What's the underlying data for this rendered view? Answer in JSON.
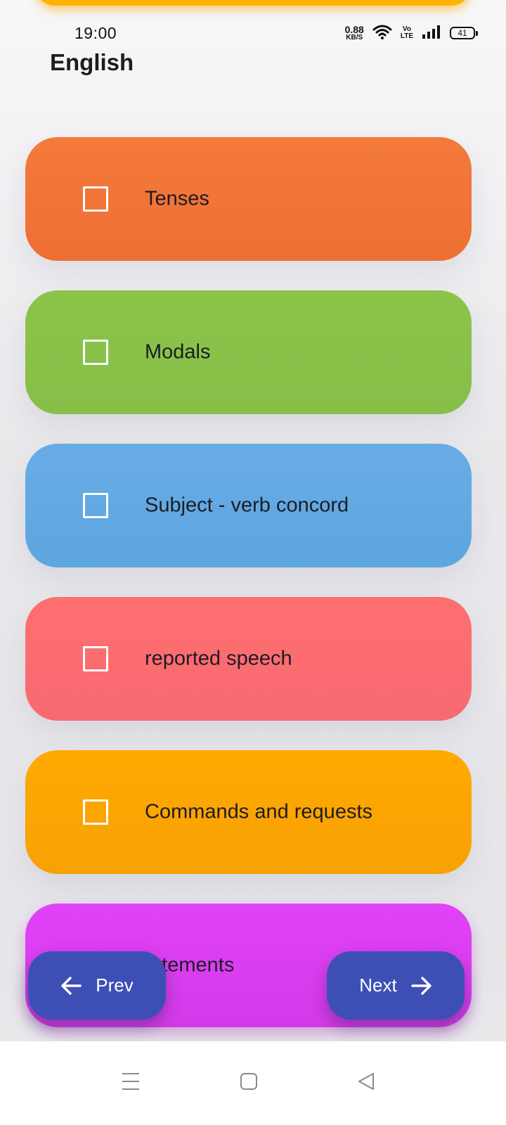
{
  "status_bar": {
    "time": "19:00",
    "net_speed_value": "0.88",
    "net_speed_unit": "KB/S",
    "volte_top": "Vo",
    "volte_bottom": "LTE",
    "battery": "41"
  },
  "header": {
    "title": "English"
  },
  "topics": [
    {
      "label": "Tenses",
      "color": "#f47a3c",
      "checked": false
    },
    {
      "label": "Modals",
      "color": "#8cc44a",
      "checked": false
    },
    {
      "label": "Subject - verb concord",
      "color": "#68ace6",
      "checked": false
    },
    {
      "label": "reported speech",
      "color": "#ff6f6f",
      "checked": false
    },
    {
      "label": "Commands and requests",
      "color": "#ffa901",
      "checked": false
    },
    {
      "label": "tatements",
      "color": "#e242f8",
      "checked": false
    }
  ],
  "navigation": {
    "prev_label": "Prev",
    "next_label": "Next",
    "button_color": "#3d4fb5"
  },
  "icons": {
    "prev": "arrow-left-icon",
    "next": "arrow-right-icon",
    "wifi": "wifi-icon",
    "signal": "signal-icon",
    "battery": "battery-icon",
    "system_menu": "menu-icon",
    "system_home": "home-icon",
    "system_back": "back-icon"
  }
}
